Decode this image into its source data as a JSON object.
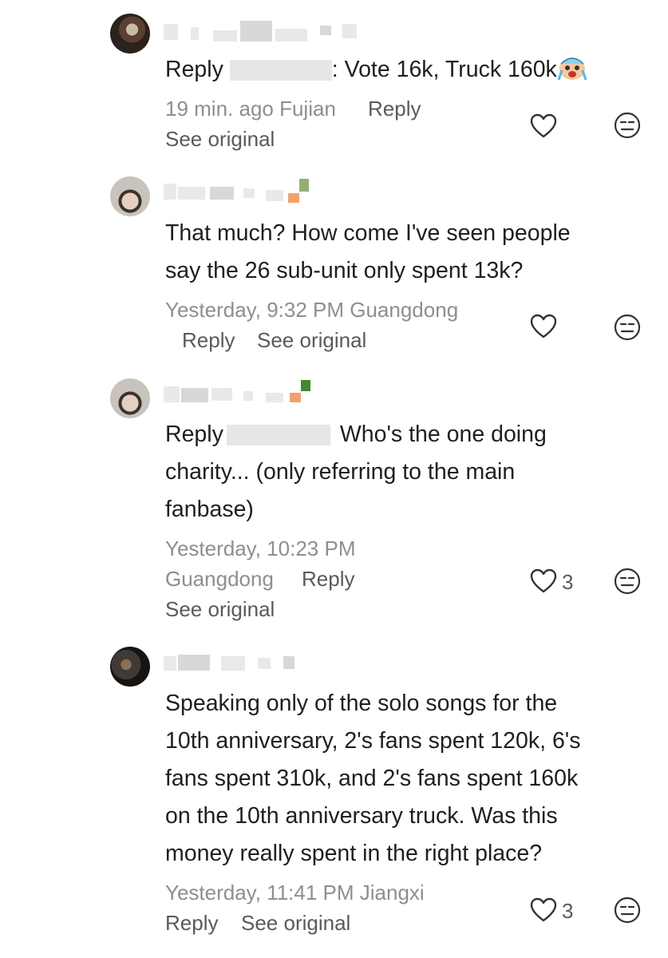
{
  "comments": [
    {
      "reply_prefix": "Reply",
      "reply_suffix": ": Vote 16k, Truck 160k",
      "time_location": "19 min. ago Fujian",
      "reply_label": "Reply",
      "see_original": "See original",
      "emoji": "crying-face-emoji"
    },
    {
      "text_line1": "That much? How come I've seen people",
      "text_line2": "say the 26 sub-unit only spent 13k?",
      "time_location": "Yesterday, 9:32 PM Guangdong",
      "reply_label": "Reply",
      "see_original": "See original"
    },
    {
      "reply_prefix": "Reply",
      "text_line1_rest": "Who's the one doing",
      "text_line2": "charity... (only referring to the main",
      "text_line3": "fanbase)",
      "time": "Yesterday, 10:23 PM",
      "location": "Guangdong",
      "reply_label": "Reply",
      "see_original": "See original",
      "likes": "3"
    },
    {
      "text_line1": "Speaking only of the solo songs for the",
      "text_line2": "10th anniversary, 2's fans spent 120k, 6's",
      "text_line3": "fans spent 310k, and 2's fans spent 160k",
      "text_line4": "on the 10th anniversary truck. Was this",
      "text_line5": "money really spent in the right place?",
      "time_location": "Yesterday, 11:41 PM Jiangxi",
      "reply_label": "Reply",
      "see_original": "See original",
      "likes": "3"
    }
  ],
  "icons": {
    "like": "heart-outline-icon",
    "dislike": "neutral-face-icon"
  }
}
